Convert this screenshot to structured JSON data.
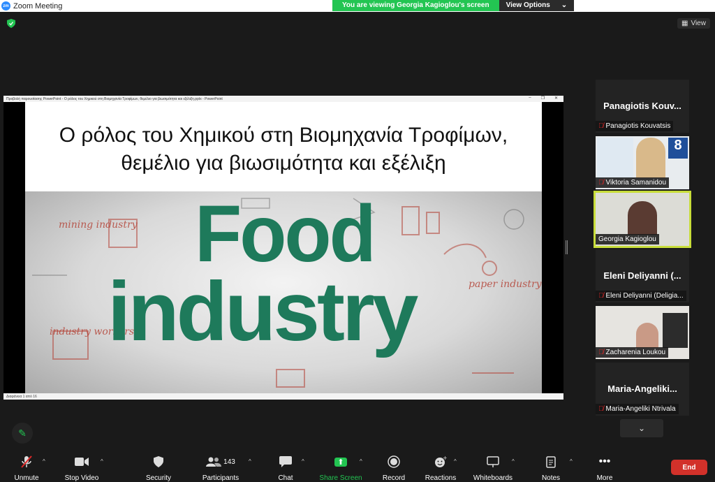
{
  "window": {
    "title": "Zoom Meeting",
    "logo_text": "zm"
  },
  "banner": {
    "viewing": "You are viewing Georgia Kagioglou's screen",
    "view_options": "View Options"
  },
  "view_button": "View",
  "ppt": {
    "window_title": "Προβολή παρουσίασης PowerPoint - Ο ρόλος του Χημικού στη Βιομηχανία Τροφίμων, θεμέλιο για βιωσιμότητα και εξέλιξη.pptx - PowerPoint",
    "status": "Διαφάνεια 1 από 16",
    "slide_title_line1": "Ο ρόλος του Χημικού στη Βιομηχανία Τροφίμων,",
    "slide_title_line2": "θεμέλιο για βιωσιμότητα και εξέλιξη",
    "image_word1": "Food",
    "image_word2": "industry",
    "doodles": [
      "mining industry",
      "industry workers",
      "paper industry"
    ]
  },
  "participants": [
    {
      "big_name": "Panagiotis Kouv...",
      "label": "Panagiotis Kouvatsis",
      "muted": true,
      "video": false
    },
    {
      "big_name": "",
      "label": "Viktoria Samanidou",
      "muted": true,
      "video": true
    },
    {
      "big_name": "",
      "label": "Georgia Kagioglou",
      "muted": false,
      "video": true,
      "active": true
    },
    {
      "big_name": "Eleni Deliyanni (...",
      "label": "Eleni Deliyanni (Deligia...",
      "muted": true,
      "video": false
    },
    {
      "big_name": "",
      "label": "Zacharenia Loukou",
      "muted": true,
      "video": true
    },
    {
      "big_name": "Maria-Angeliki...",
      "label": "Maria-Angeliki Ntrivala",
      "muted": true,
      "video": false
    }
  ],
  "toolbar": {
    "unmute": "Unmute",
    "stop_video": "Stop Video",
    "security": "Security",
    "participants": "Participants",
    "participants_count": "143",
    "chat": "Chat",
    "share_screen": "Share Screen",
    "record": "Record",
    "reactions": "Reactions",
    "whiteboards": "Whiteboards",
    "notes": "Notes",
    "more": "More",
    "end": "End"
  },
  "colors": {
    "accent_green": "#23c552",
    "end_red": "#d2312a",
    "active_speaker": "#c8dd3a",
    "food_green": "#1e7a5b"
  }
}
